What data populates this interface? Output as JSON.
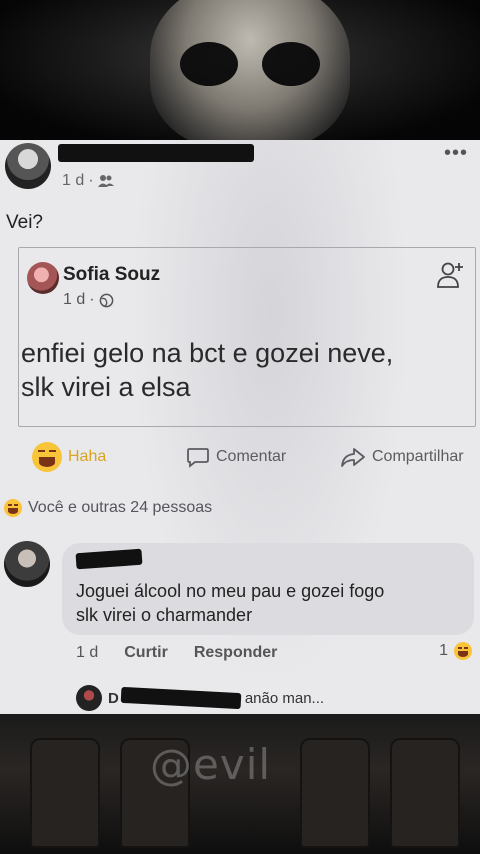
{
  "post": {
    "time": "1 d",
    "privacy_icon": "friends-icon",
    "more_icon": "more-dots-icon",
    "more_glyph": "•••",
    "text": "Vei?"
  },
  "shared_post": {
    "author": "Sofia Souz",
    "time": "1 d",
    "privacy_icon": "globe-icon",
    "text_line1": "enfiei gelo na bct e gozei neve,",
    "text_line2": "slk virei a elsa"
  },
  "actions": {
    "haha": "Haha",
    "comment": "Comentar",
    "share": "Compartilhar"
  },
  "reactions": {
    "summary": "Você e outras 24 pessoas"
  },
  "comment": {
    "text_line1": "Joguei álcool no meu pau e gozei fogo",
    "text_line2": "slk virei o charmander",
    "time": "1 d",
    "like": "Curtir",
    "reply": "Responder",
    "reaction_count": "1"
  },
  "reply_preview": {
    "author_initial": "D",
    "text": "anão man..."
  },
  "watermark": "@evil",
  "colors": {
    "card_bg": "#e9e9ec",
    "haha_yellow": "#f7c43a",
    "bubble_bg": "#dcdce0"
  }
}
